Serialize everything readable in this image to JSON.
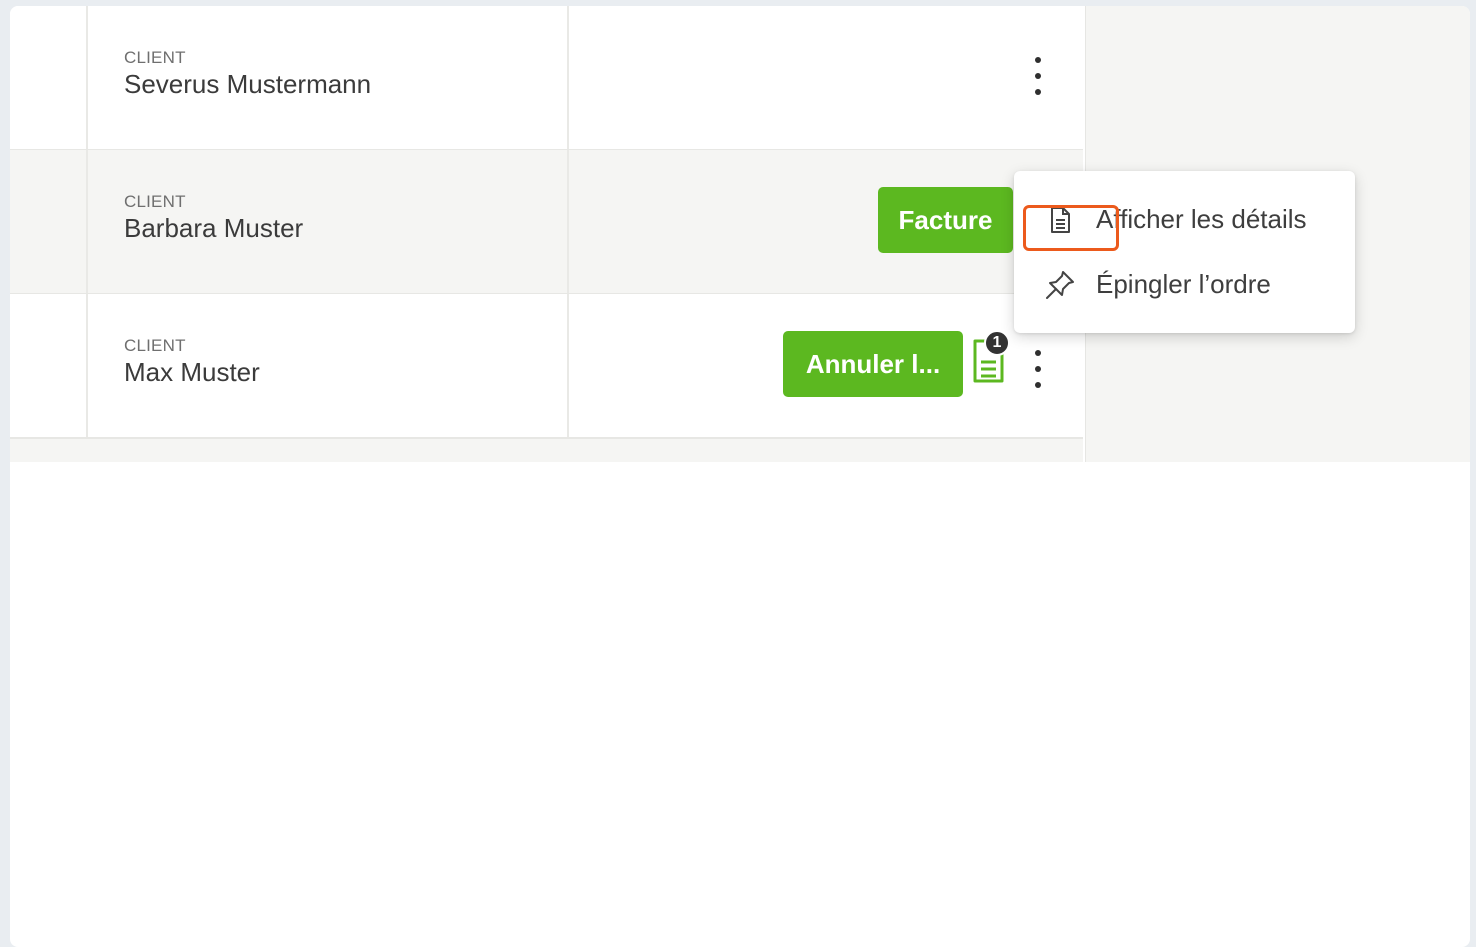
{
  "rows": [
    {
      "label": "CLIENT",
      "name": "Severus Mustermann"
    },
    {
      "label": "CLIENT",
      "name": "Barbara Muster",
      "action_label": "Facture"
    },
    {
      "label": "CLIENT",
      "name": "Max Muster",
      "action_label": "Annuler l...",
      "doc_badge_count": "1"
    }
  ],
  "context_menu": {
    "items": [
      {
        "label": "Afficher les détails",
        "icon": "document-icon"
      },
      {
        "label": "Épingler l’ordre",
        "icon": "pin-icon"
      }
    ]
  },
  "colors": {
    "accent_green": "#5cb820",
    "highlight_orange": "#ec5a1c",
    "badge_dark": "#333333"
  }
}
